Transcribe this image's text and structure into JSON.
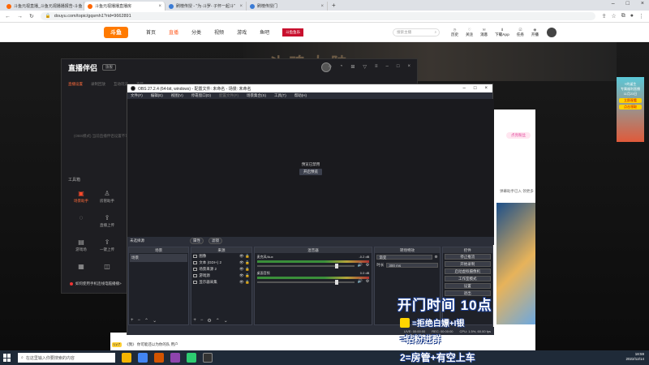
{
  "browser": {
    "tabs": [
      {
        "title": "斗鱼元视直播_斗鱼元视播播报告-斗鱼",
        "active": false
      },
      {
        "title": "斗鱼元视播播直播房",
        "active": true
      },
      {
        "title": "刷榜传授 - \"为·斗罗- 子怀一起斗\"",
        "active": false
      },
      {
        "title": "刷榜传授门",
        "active": false
      }
    ],
    "new_tab": "+",
    "url": "douyu.com/topic/gqsmh1?rid=9662891"
  },
  "site": {
    "logo": "斗鱼",
    "nav": [
      "首页",
      "直播",
      "分类",
      "视频",
      "游戏",
      "鱼吧"
    ],
    "active_nav": "直播",
    "promo": "斗鱼鱼乐",
    "search_placeholder": "搜索主播",
    "header_icons": [
      "历史",
      "关注",
      "消息",
      "下载App",
      "任务",
      "开播"
    ]
  },
  "banner_text": "斗魂大陆",
  "right_ad": {
    "title": "Y的诞生",
    "lines": [
      "专属福利直播",
      "11月23日"
    ],
    "btn": "立即观看",
    "btn2": "点击领取"
  },
  "page_right": {
    "tag": "点亮粉丝",
    "hint": "弹幕助手已入 领更多"
  },
  "zbw": {
    "title": "直播伴侣",
    "version": "旗舰",
    "tabs": [
      "直播设置",
      "录制回放",
      "互动玩法",
      "高级"
    ],
    "hint": "(OBS模式) 当前直播伴侣设置不可",
    "tools_title": "工具箱",
    "tools": [
      {
        "label": "场景助手",
        "icon": "camera-icon",
        "active": true
      },
      {
        "label": "房管助手",
        "icon": "user-icon",
        "active": false
      },
      {
        "label": "",
        "icon": "",
        "active": false
      },
      {
        "label": "",
        "icon": "hot-icon",
        "active": false
      },
      {
        "label": "直播上传",
        "icon": "upload-icon",
        "active": false
      },
      {
        "label": "",
        "icon": "",
        "active": false
      },
      {
        "label": "游戏场",
        "icon": "game-icon",
        "active": false
      },
      {
        "label": "一键上传",
        "icon": "upload-icon",
        "active": false
      },
      {
        "label": "",
        "icon": "",
        "active": false
      },
      {
        "label": "",
        "icon": "film-icon",
        "active": false
      },
      {
        "label": "",
        "icon": "gamepad-icon",
        "active": false
      },
      {
        "label": "",
        "icon": "",
        "active": false
      }
    ],
    "footer": "如何使用手机连线电脑播播>"
  },
  "obs": {
    "title": "OBS 27.2.4 (64-bit, windows) - 配置文件: 未命名 - 场景: 未命名",
    "menu": [
      "文件(F)",
      "编辑(E)",
      "视图(V)",
      "停靠窗口(D)",
      "配置文件(P)",
      "场景集合(S)",
      "工具(T)",
      "帮助(H)"
    ],
    "disabled_menu": "配置文件(P)",
    "preview_msg": "预览已禁用",
    "preview_btn": "开启预览",
    "scene_bar": "未选择源",
    "scene_bar_radios": [
      "属性",
      "滤镜"
    ],
    "docks": {
      "scenes": {
        "title": "场景",
        "items": [
          "场景"
        ]
      },
      "sources": {
        "title": "来源",
        "items": [
          "图像",
          "文本 (GDI+) 2",
          "场景来源 2",
          "游戏源",
          "显示器采集"
        ]
      },
      "mixer": {
        "title": "混音器",
        "channels": [
          {
            "name": "麦克风/Aux",
            "db": "-0.2 dB"
          },
          {
            "name": "桌面音频",
            "db": "0.0 dB"
          }
        ]
      },
      "transitions": {
        "title": "转场特效",
        "selected": "渐变",
        "duration_label": "时长",
        "duration": "300 ms"
      },
      "controls": {
        "title": "控件",
        "buttons": [
          "停止推流",
          "开始录制",
          "启动虚拟摄像机",
          "工作室模式",
          "设置",
          "退出"
        ]
      }
    },
    "status": [
      "LIVE: 00:00:00",
      "REC: 00:00:00",
      "CPU: 1.5%, 60.00 fps"
    ]
  },
  "overlay": {
    "line1": "开门时间 10点",
    "line2": "=拒绝白嫖+I银",
    "line3": "=钻粉进群",
    "line4": "2=房管+有空上车"
  },
  "chat": {
    "level": "Lv.7",
    "text": "《我》 你可能还以为你的队 用户"
  },
  "taskbar": {
    "search_placeholder": "在这里输入你要搜索的内容",
    "time": "18:59",
    "date": "2022/12/14"
  }
}
